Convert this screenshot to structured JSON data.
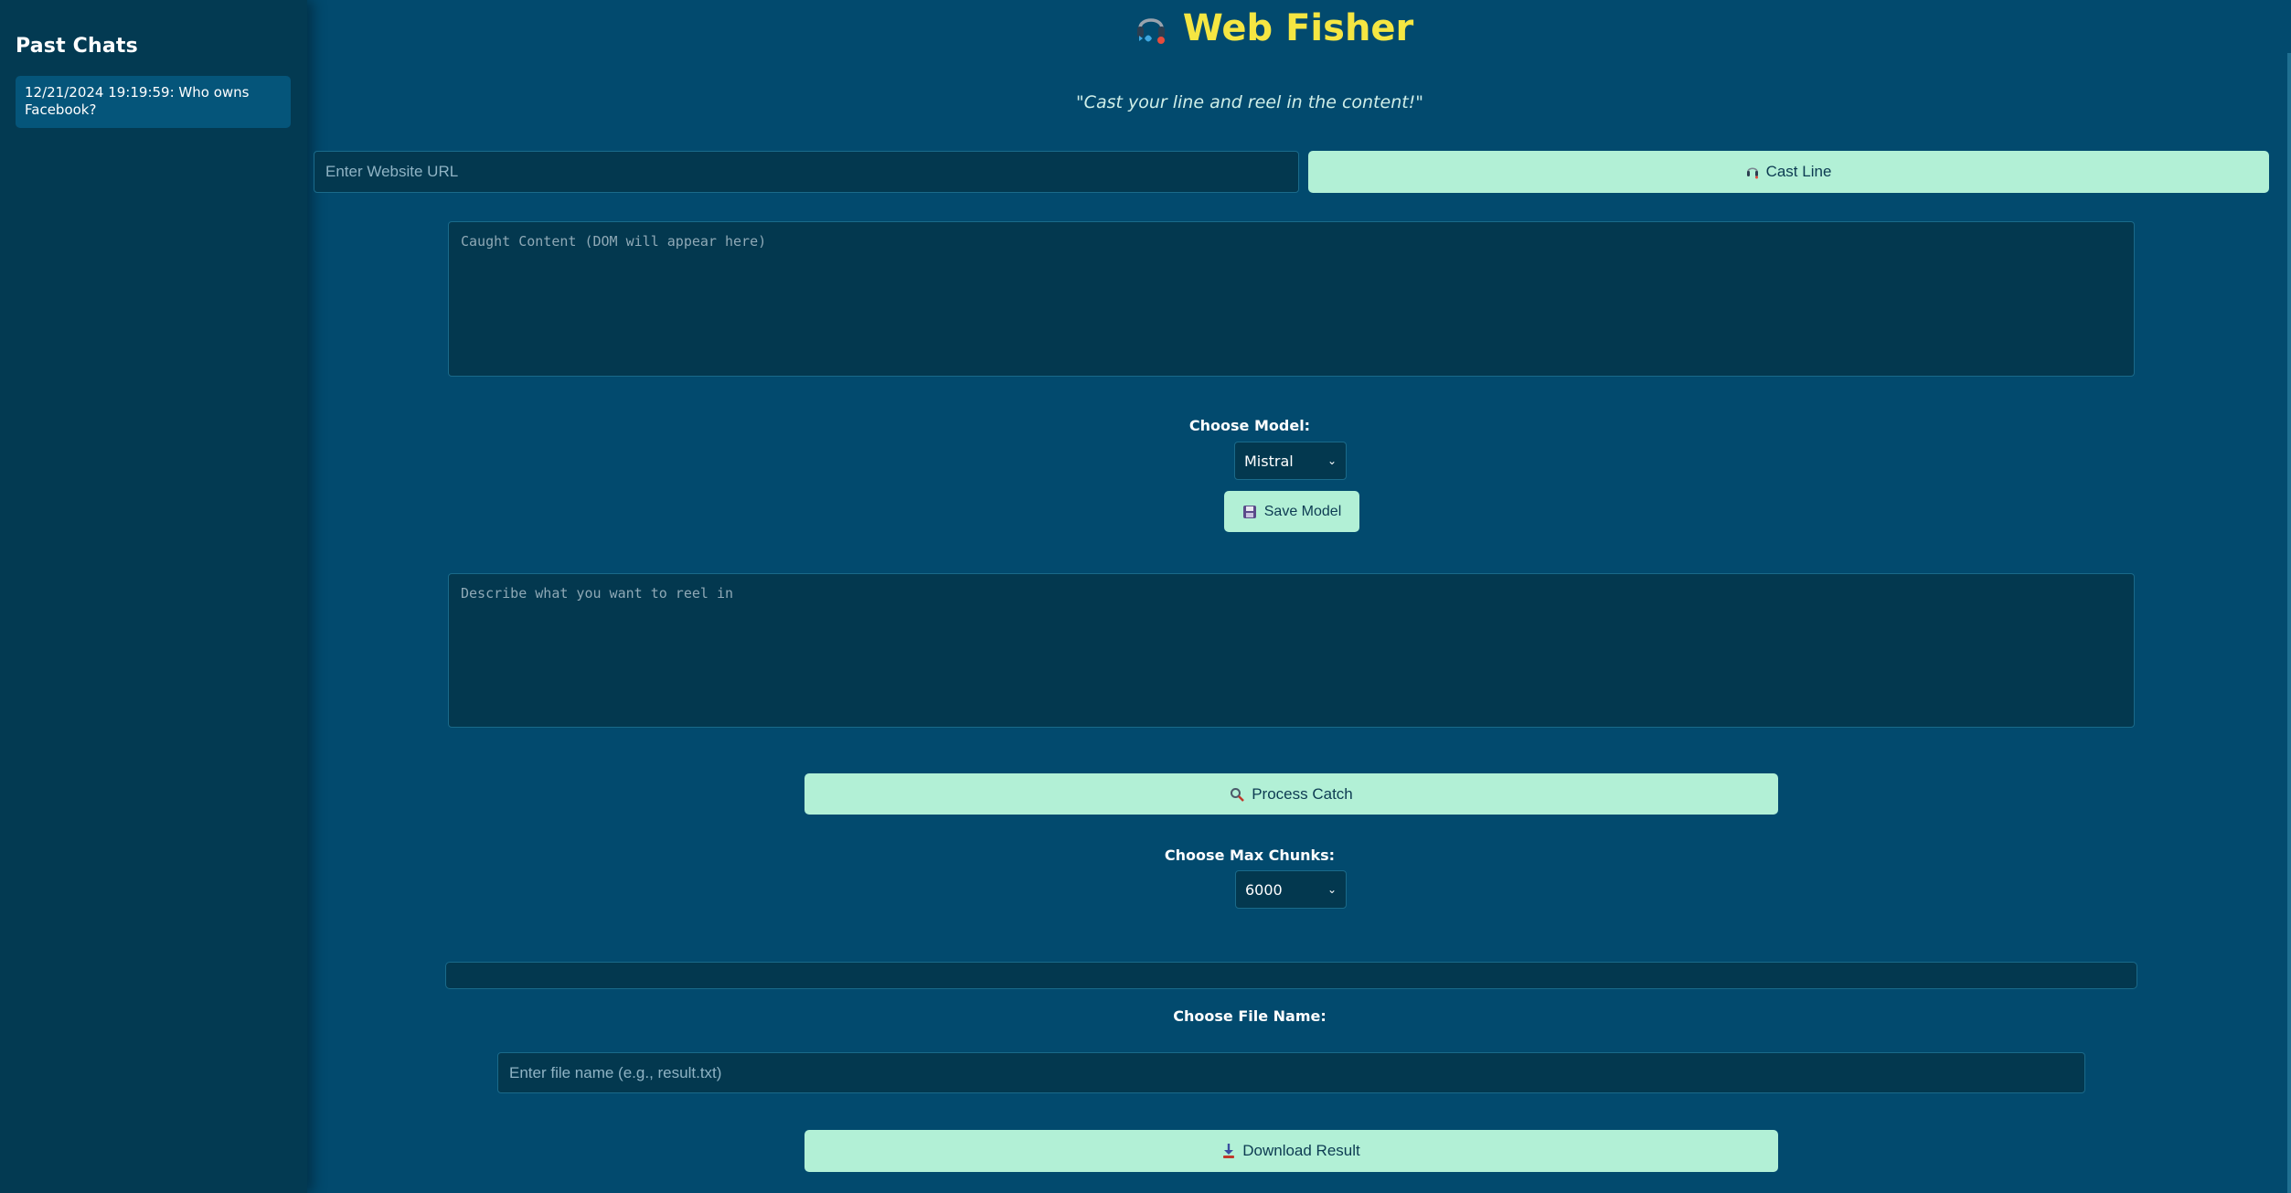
{
  "sidebar": {
    "title": "Past Chats",
    "items": [
      {
        "label": "12/21/2024 19:19:59: Who owns Facebook?"
      }
    ]
  },
  "header": {
    "title": "Web Fisher",
    "icon": "headset-icon",
    "tagline": "\"Cast your line and reel in the content!\""
  },
  "url": {
    "placeholder": "Enter Website URL",
    "value": ""
  },
  "cast_button": {
    "label": "Cast Line",
    "icon": "headset-icon"
  },
  "caught_content": {
    "placeholder": "Caught Content (DOM will appear here)",
    "value": ""
  },
  "model": {
    "label": "Choose Model:",
    "selected": "Mistral",
    "save_label": "Save Model",
    "save_icon": "floppy-disk-icon"
  },
  "describe": {
    "placeholder": "Describe what you want to reel in",
    "value": ""
  },
  "process_button": {
    "label": "Process Catch",
    "icon": "magnifier-icon"
  },
  "chunks": {
    "label": "Choose Max Chunks:",
    "selected": "6000"
  },
  "file": {
    "label": "Choose File Name:",
    "placeholder": "Enter file name (e.g., result.txt)",
    "value": ""
  },
  "download_button": {
    "label": "Download Result",
    "icon": "download-icon"
  },
  "colors": {
    "background": "#024a6e",
    "sidebar": "#033a52",
    "accent_mint": "#b2f0d6",
    "title_yellow": "#f5e642"
  }
}
